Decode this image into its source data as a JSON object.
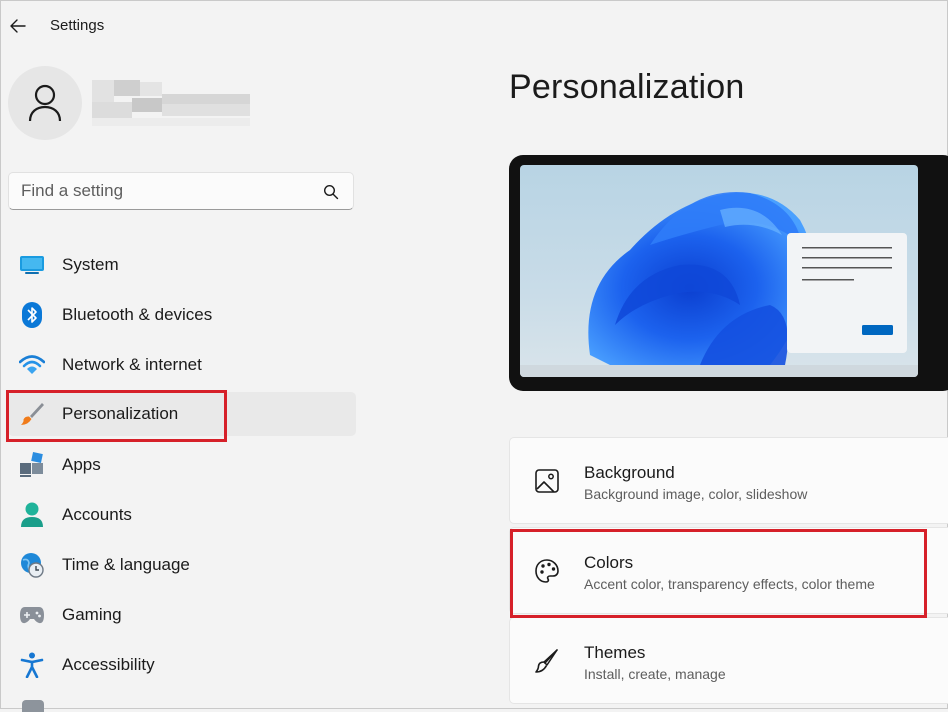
{
  "window": {
    "title": "Settings"
  },
  "search": {
    "placeholder": "Find a setting"
  },
  "sidebar": {
    "items": [
      {
        "label": "System",
        "icon": "monitor-icon"
      },
      {
        "label": "Bluetooth & devices",
        "icon": "bluetooth-icon"
      },
      {
        "label": "Network & internet",
        "icon": "wifi-icon"
      },
      {
        "label": "Personalization",
        "icon": "paintbrush-icon",
        "selected": true
      },
      {
        "label": "Apps",
        "icon": "apps-icon"
      },
      {
        "label": "Accounts",
        "icon": "person-icon"
      },
      {
        "label": "Time & language",
        "icon": "globe-clock-icon"
      },
      {
        "label": "Gaming",
        "icon": "gamepad-icon"
      },
      {
        "label": "Accessibility",
        "icon": "accessibility-icon"
      }
    ]
  },
  "main": {
    "title": "Personalization",
    "cards": [
      {
        "title": "Background",
        "subtitle": "Background image, color, slideshow",
        "icon": "image-icon"
      },
      {
        "title": "Colors",
        "subtitle": "Accent color, transparency effects, color theme",
        "icon": "palette-icon"
      },
      {
        "title": "Themes",
        "subtitle": "Install, create, manage",
        "icon": "brush-icon"
      }
    ]
  },
  "colors": {
    "accent": "#0067c0",
    "highlight": "#d62029",
    "background": "#f3f3f3"
  }
}
